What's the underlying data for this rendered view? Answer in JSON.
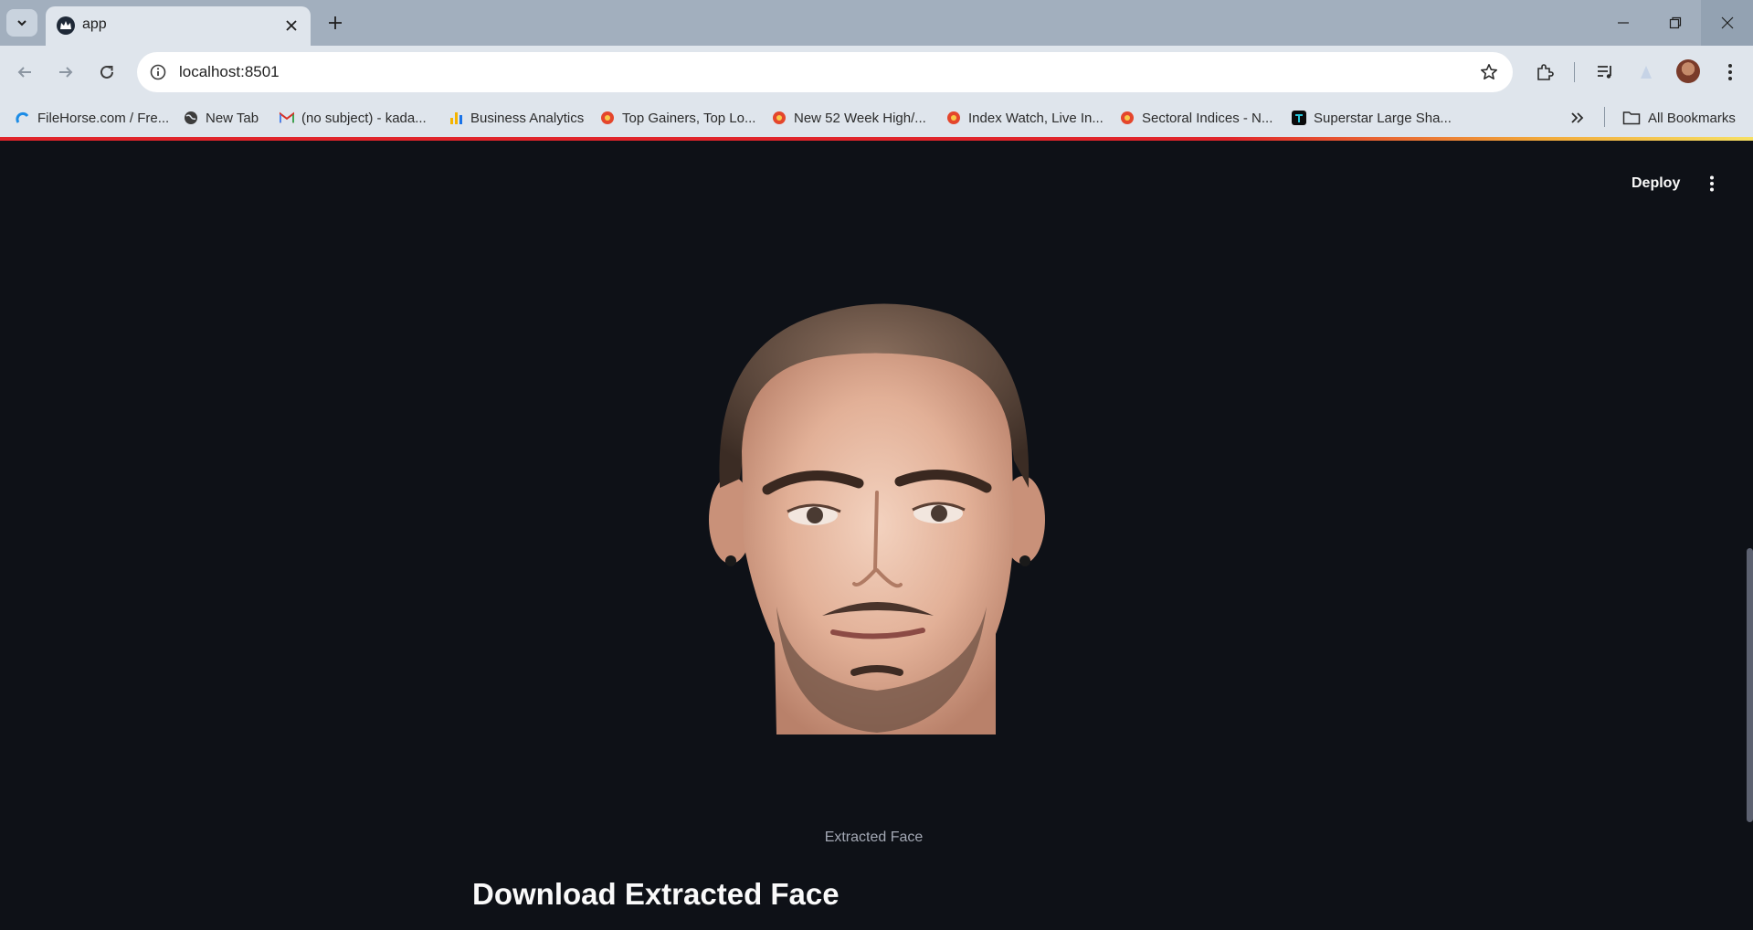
{
  "browser": {
    "tab_title": "app",
    "url": "localhost:8501"
  },
  "bookmarks": [
    {
      "label": "FileHorse.com / Fre...",
      "icon": "filehorse-icon"
    },
    {
      "label": "New Tab",
      "icon": "globe-icon"
    },
    {
      "label": "(no subject) - kada...",
      "icon": "gmail-icon"
    },
    {
      "label": "Business Analytics",
      "icon": "analytics-icon"
    },
    {
      "label": "Top Gainers, Top Lo...",
      "icon": "moneycontrol-icon"
    },
    {
      "label": "New 52 Week High/...",
      "icon": "moneycontrol-icon"
    },
    {
      "label": "Index Watch, Live In...",
      "icon": "moneycontrol-icon"
    },
    {
      "label": "Sectoral Indices - N...",
      "icon": "moneycontrol-icon"
    },
    {
      "label": "Superstar Large Sha...",
      "icon": "trendlyne-icon"
    }
  ],
  "bookmarks_all_label": "All Bookmarks",
  "app": {
    "deploy_label": "Deploy",
    "image_caption": "Extracted Face",
    "section_heading": "Download Extracted Face"
  },
  "colors": {
    "app_background": "#0e1117",
    "chrome_frame": "#a2afbe",
    "toolbar": "#dfe5ec",
    "load_bar": "#e0252b"
  }
}
